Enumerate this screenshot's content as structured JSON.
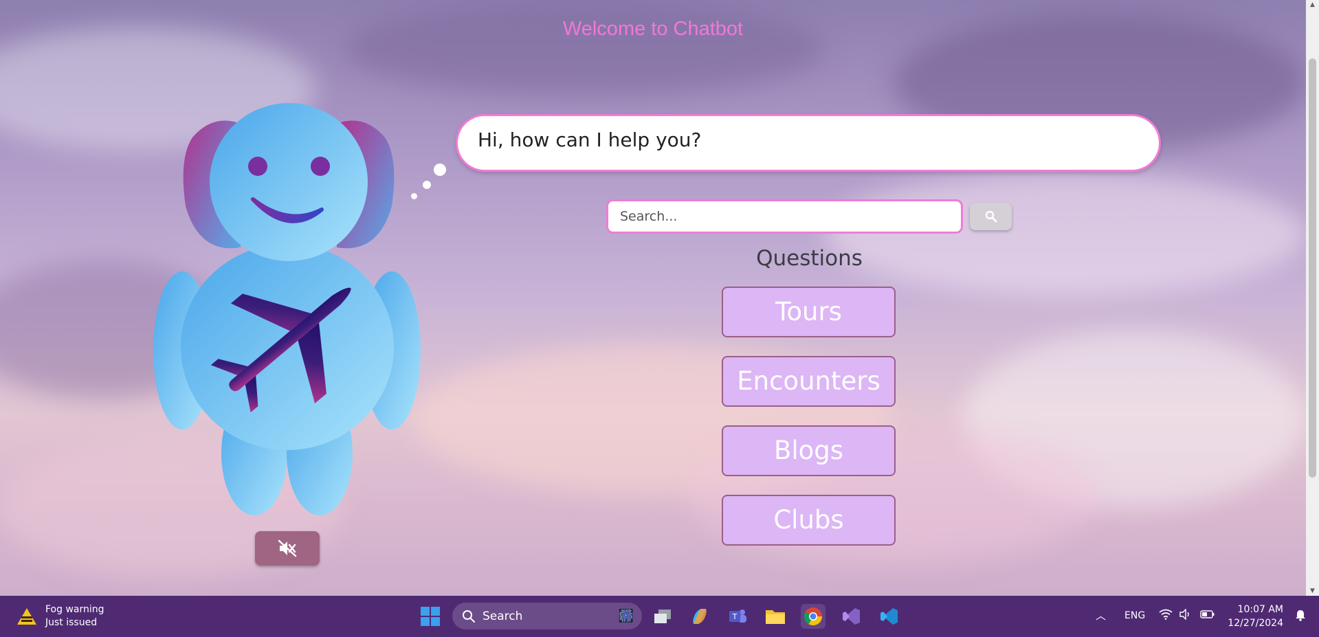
{
  "page": {
    "title": "Welcome to Chatbot",
    "greeting": "Hi, how can I help you?",
    "search": {
      "placeholder": "Search..."
    },
    "questions_title": "Questions",
    "questions": [
      {
        "label": "Tours"
      },
      {
        "label": "Encounters"
      },
      {
        "label": "Blogs"
      },
      {
        "label": "Clubs"
      }
    ],
    "mute_icon": "mute-speaker-icon"
  },
  "colors": {
    "title": "#f178d7",
    "accent_border": "#f07cd4",
    "question_bg": "#dcb6f5",
    "mute_button": "#a06582",
    "taskbar": "#4f2a73"
  },
  "taskbar": {
    "weather": {
      "title": "Fog warning",
      "subtitle": "Just issued"
    },
    "search_label": "Search",
    "language": "ENG",
    "time": "10:07 AM",
    "date": "12/27/2024"
  }
}
